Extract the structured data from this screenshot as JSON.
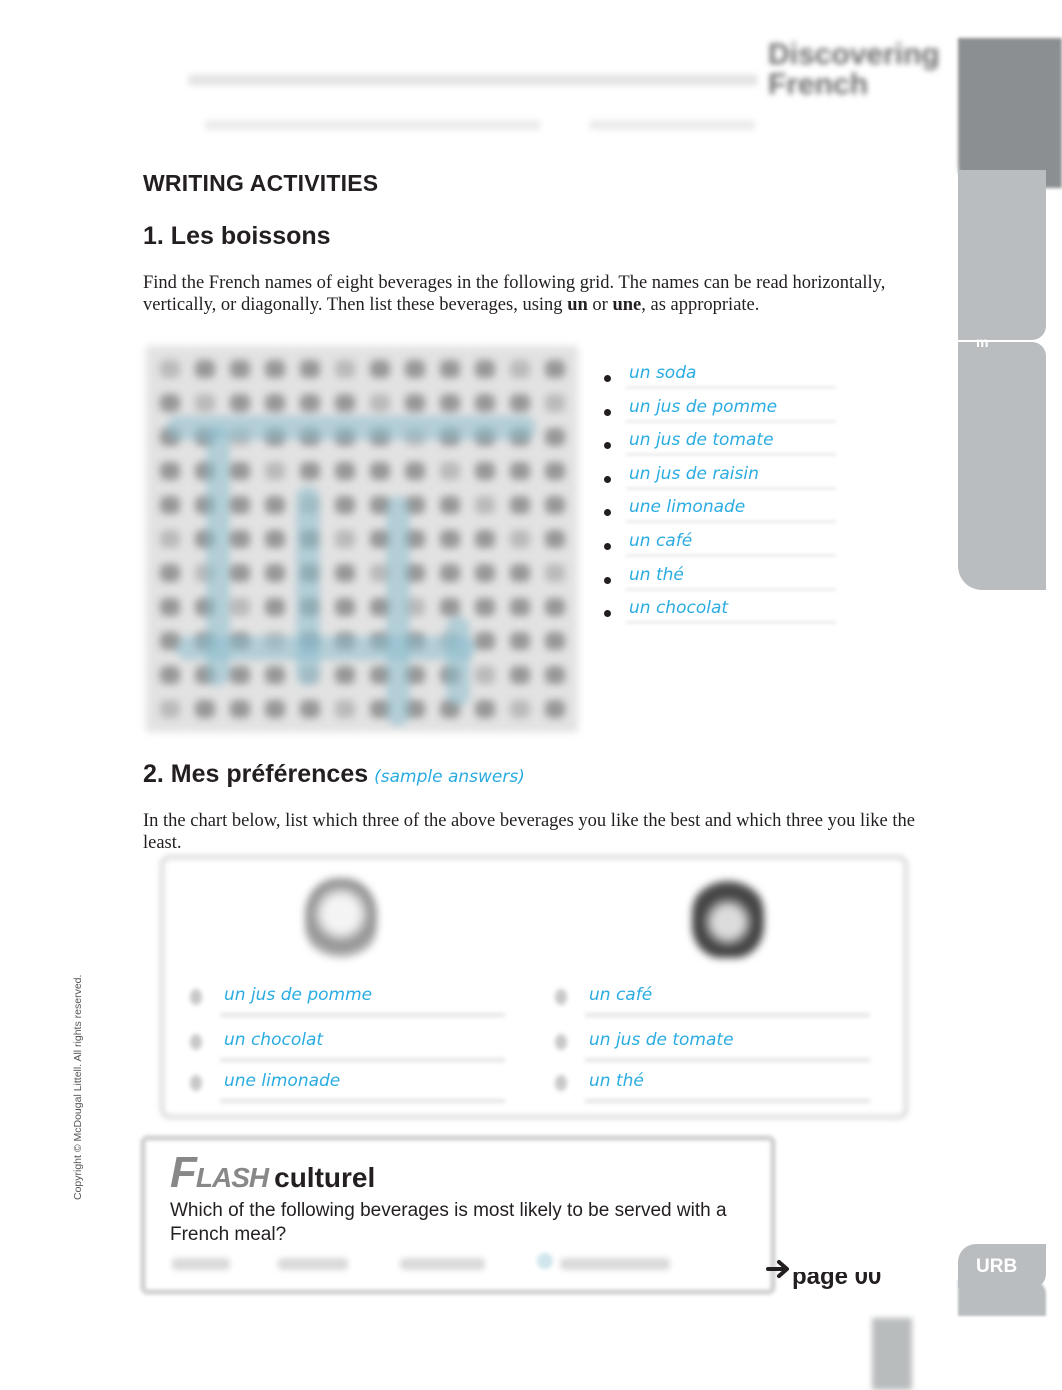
{
  "header": {
    "logo_text": "Discovering French"
  },
  "side_tabs": {
    "unit_letter": "m",
    "urb_label": "URB"
  },
  "page_title": "WRITING ACTIVITIES",
  "activity1": {
    "heading": "1. Les boissons",
    "instructions_part1": "Find the French names of eight beverages in the following grid. The names can be read horizontally, vertically, or diagonally. Then list these beverages, using ",
    "bold_un": "un",
    "instructions_or": " or ",
    "bold_une": "une",
    "instructions_part2": ", as appropriate.",
    "word_search_state": "blurred",
    "answers": [
      "un soda",
      "un jus de pomme",
      "un jus de tomate",
      "un jus de raisin",
      "une limonade",
      "un café",
      "un thé",
      "un chocolat"
    ]
  },
  "activity2": {
    "heading": "2. Mes préférences",
    "sample_note": "(sample answers)",
    "instructions": "In the chart below, list which three of the above beverages you like the best and which three you like the least.",
    "like_icon": "happy-face-icon",
    "dislike_icon": "unhappy-face-icon",
    "like_best": [
      "un jus de pomme",
      "un chocolat",
      "une limonade"
    ],
    "like_least": [
      "un café",
      "un jus de tomate",
      "un thé"
    ]
  },
  "flash_culturel": {
    "title_flash": "FLASH",
    "title_culturel": "culturel",
    "question": "Which of the following beverages is most likely to be served with a French meal?",
    "answer_ref": "page 00",
    "arrow_icon": "arrow-right-icon"
  },
  "copyright": "Copyright © McDougal Littell. All rights reserved.",
  "colors": {
    "handwriting": "#2aace2",
    "text": "#231f20",
    "tab_gray": "#babdbf"
  }
}
